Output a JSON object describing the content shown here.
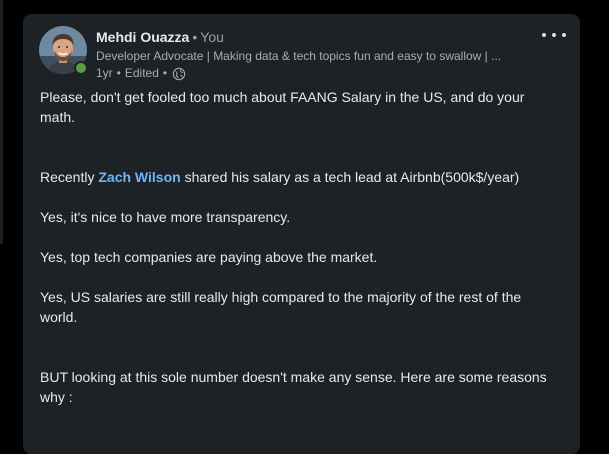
{
  "post": {
    "author": {
      "name": "Mehdi Ouazza",
      "separator": "•",
      "relation": "You",
      "headline": "Developer Advocate | Making data & tech topics fun and easy to swallow | ...",
      "age": "1yr",
      "meta_dot": "•",
      "edited": "Edited",
      "meta_dot2": "•",
      "visibility_icon": "globe-icon",
      "presence_color": "#5f9b41"
    },
    "menu_icon": "more-horizontal-icon",
    "body": {
      "p1": "Please, don't get fooled too much about FAANG Salary in the US, and do your math.",
      "p2_prefix": "Recently ",
      "p2_mention": "Zach Wilson",
      "p2_suffix": " shared his salary as a tech lead at Airbnb(500k$/year)",
      "p3": "Yes, it's nice to have more transparency.",
      "p4": "Yes, top tech companies are paying above the market.",
      "p5": "Yes, US salaries are still really high compared to the majority of the rest of the world.",
      "p6": "BUT looking at this sole number doesn't make any sense. Here are some reasons why :"
    }
  },
  "colors": {
    "background": "#000000",
    "card": "#1d2226",
    "text": "#e9e9e9",
    "muted": "#a8adb2",
    "mention": "#70b5f9"
  }
}
